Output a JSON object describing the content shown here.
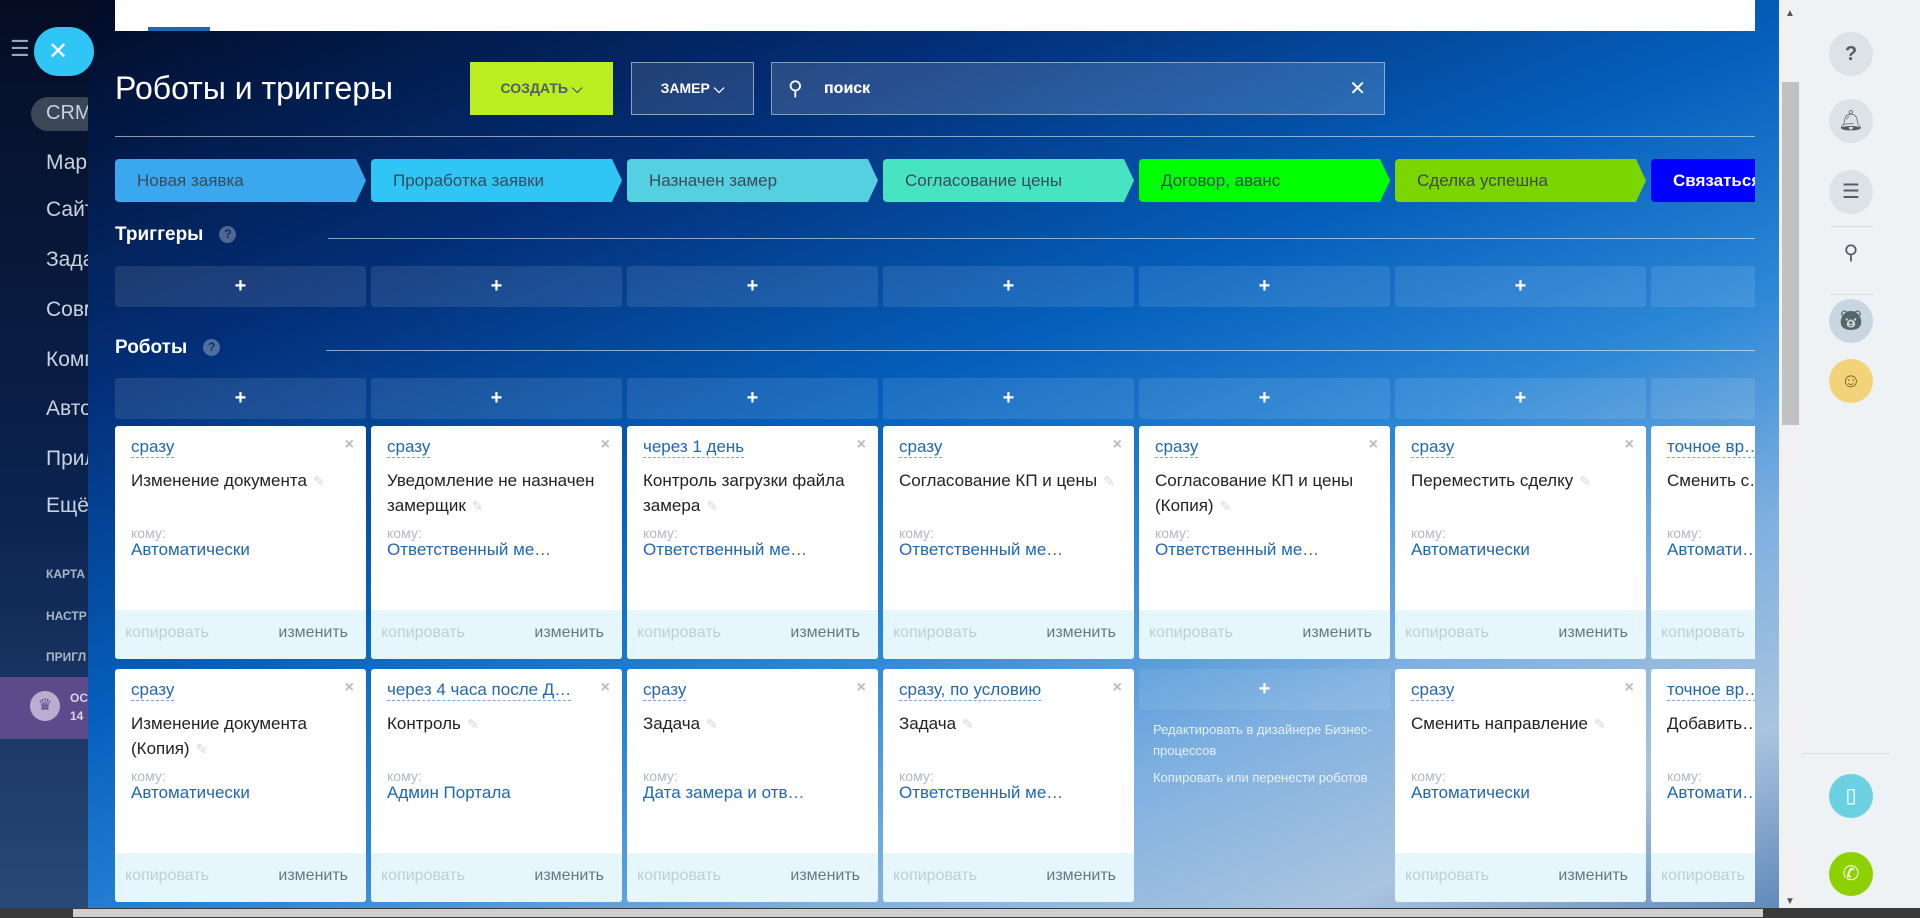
{
  "leftnav": {
    "crm": "CRM",
    "items": [
      "Мар",
      "Сайт",
      "Зада",
      "Совм",
      "Комп",
      "Авто",
      "Прил",
      "Ещё"
    ],
    "captions": [
      "КАРТА",
      "НАСТР",
      "ПРИГЛ"
    ],
    "promo": [
      "ОС",
      "14"
    ]
  },
  "header": {
    "title": "Роботы и триггеры",
    "create_label": "СОЗДАТЬ ⌵",
    "zamer_label": "ЗАМЕР ⌵",
    "search_value": "поиск",
    "search_placeholder": "поиск"
  },
  "stages": [
    {
      "label": "Новая заявка",
      "color": "#39a8ef",
      "text": "#3c4a5a"
    },
    {
      "label": "Проработка заявки",
      "color": "#2fc6f6",
      "text": "#3c4a5a"
    },
    {
      "label": "Назначен замер",
      "color": "#55d0e0",
      "text": "#3c4a5a"
    },
    {
      "label": "Согласование цены",
      "color": "#47e4c2",
      "text": "#3c4a5a"
    },
    {
      "label": "Договор, аванс",
      "color": "#00ff00",
      "text": "#3c4a5a"
    },
    {
      "label": "Сделка успешна",
      "color": "#7bd500",
      "text": "#3c4a5a"
    },
    {
      "label": "Связаться",
      "color": "#0000ff",
      "text": "#ffffff"
    }
  ],
  "sections": {
    "triggers": "Триггеры",
    "robots": "Роботы",
    "help": "?",
    "add": "+"
  },
  "card_labels": {
    "komu": "кому:",
    "copy": "копировать",
    "edit": "изменить",
    "close": "×",
    "pencil": "✎"
  },
  "robots_row1": [
    {
      "delay": "сразу",
      "name": "Изменение документа",
      "who": "Автоматически"
    },
    {
      "delay": "сразу",
      "name": "Уведомление не назначен замерщик",
      "who": "Ответственный ме…"
    },
    {
      "delay": "через 1 день",
      "name": "Контроль загрузки файла замера",
      "who": "Ответственный ме…"
    },
    {
      "delay": "сразу",
      "name": "Согласование КП и цены",
      "who": "Ответственный ме…"
    },
    {
      "delay": "сразу",
      "name": "Согласование КП и цены (Копия)",
      "who": "Ответственный ме…"
    },
    {
      "delay": "сразу",
      "name": "Переместить сделку",
      "who": "Автоматически"
    },
    {
      "delay": "точное вр…",
      "name": "Сменить с…",
      "who": "Автомати…"
    }
  ],
  "robots_row2": [
    {
      "delay": "сразу",
      "name": "Изменение документа (Копия)",
      "who": "Автоматически"
    },
    {
      "delay": "через 4 часа после Д…",
      "name": "Контроль",
      "who": "Админ Портала"
    },
    {
      "delay": "сразу",
      "name": "Задача",
      "who": "Дата замера и отв…"
    },
    {
      "delay": "сразу, по условию",
      "name": "Задача",
      "who": "Ответственный ме…"
    },
    null,
    {
      "delay": "сразу",
      "name": "Сменить направление",
      "who": "Автоматически"
    },
    {
      "delay": "точное вр…",
      "name": "Добавить…",
      "who": "Автомати…"
    }
  ],
  "empty_column": {
    "edit_designer": "Редактировать в дизайнере Бизнес-процессов",
    "copy_move": "Копировать или перенести роботов"
  },
  "right_panel": {
    "icons": [
      "help-icon",
      "bell-icon",
      "chat-icon",
      "search-icon",
      "avatar-bear",
      "avatar-woman",
      "phone-cloud-icon",
      "call-icon"
    ]
  }
}
